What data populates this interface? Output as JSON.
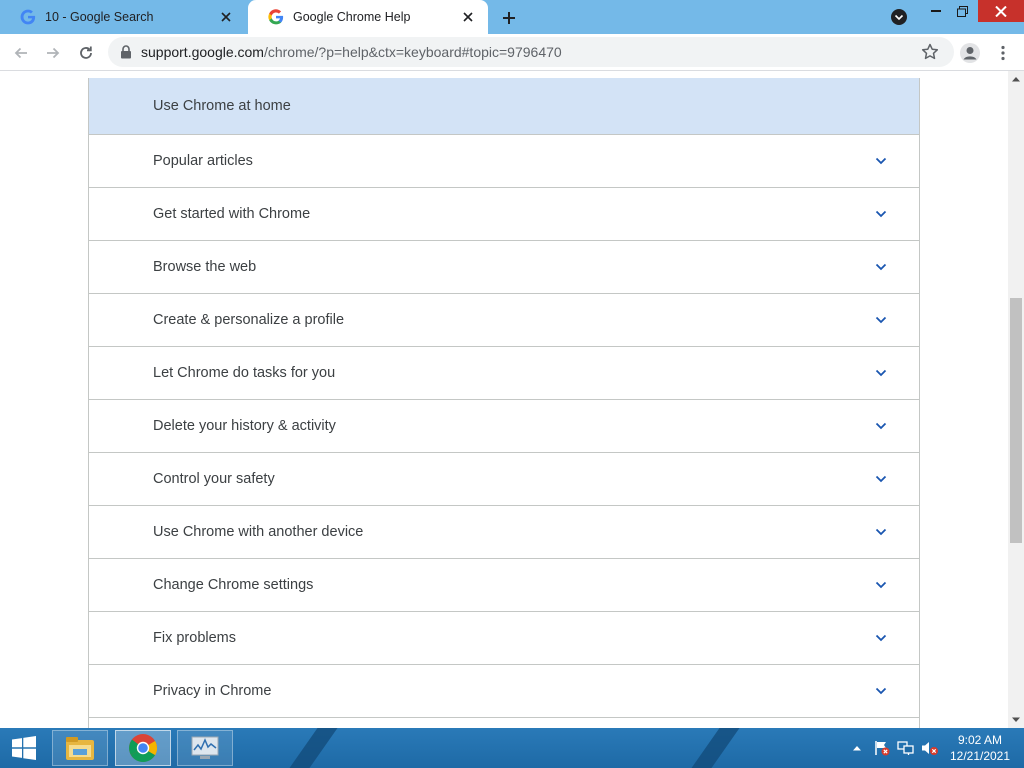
{
  "browser": {
    "tabs": [
      {
        "title": "10 - Google Search",
        "active": false,
        "favicon": "google-g-icon"
      },
      {
        "title": "Google Chrome Help",
        "active": true,
        "favicon": "google-g-icon"
      }
    ],
    "url": {
      "host": "support.google.com",
      "path": "/chrome/?p=help&ctx=keyboard#topic=9796470"
    },
    "colors": {
      "tabstrip": "#74b9e8",
      "close_button": "#c7312b",
      "accent": "#1a56b0"
    }
  },
  "help": {
    "header": "Use Chrome at home",
    "topics": [
      "Popular articles",
      "Get started with Chrome",
      "Browse the web",
      "Create & personalize a profile",
      "Let Chrome do tasks for you",
      "Delete your history & activity",
      "Control your safety",
      "Use Chrome with another device",
      "Change Chrome settings",
      "Fix problems",
      "Privacy in Chrome",
      ""
    ]
  },
  "taskbar": {
    "clock_time": "9:02 AM",
    "clock_date": "12/21/2021",
    "pinned": [
      "file-explorer-icon",
      "chrome-icon",
      "performance-monitor-icon"
    ]
  }
}
